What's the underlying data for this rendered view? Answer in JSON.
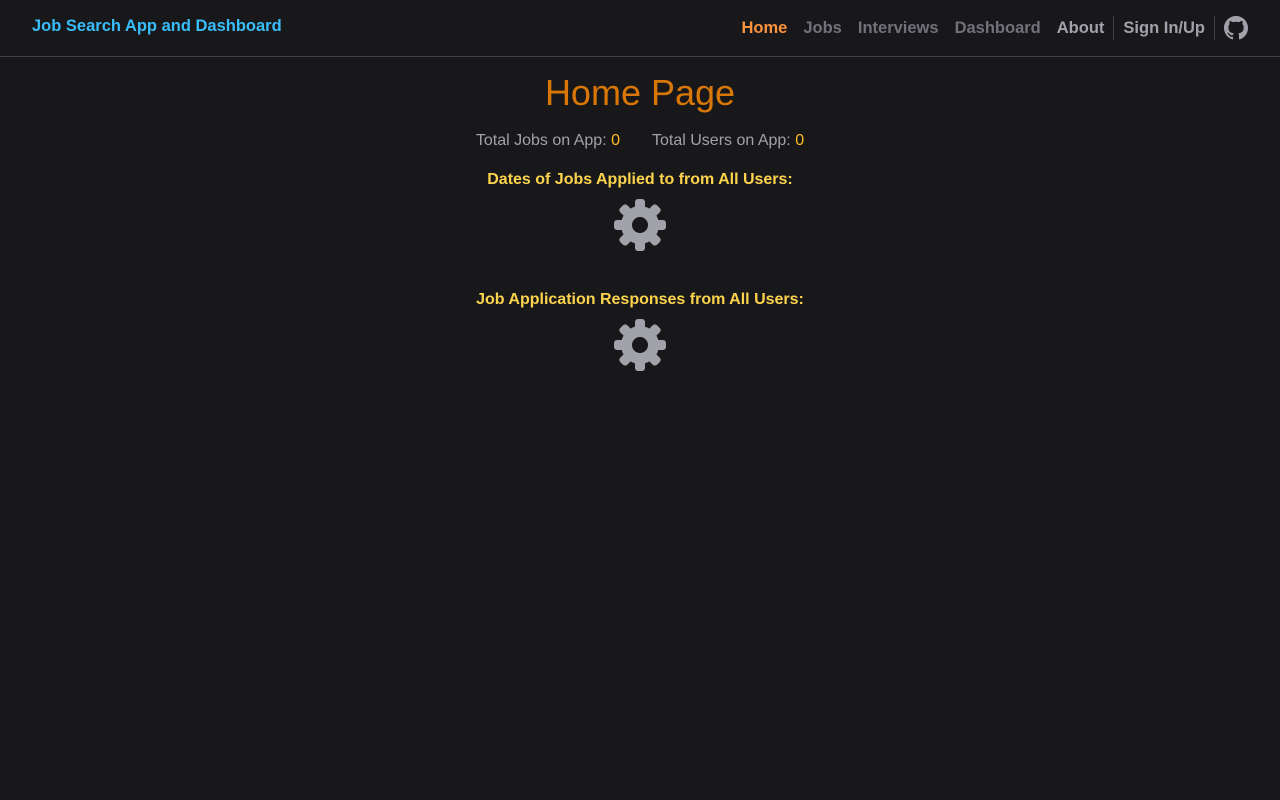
{
  "navbar": {
    "brand": "Job Search App and Dashboard",
    "links": [
      {
        "label": "Home",
        "color": "#fb923c"
      },
      {
        "label": "Jobs",
        "color": "#71717a"
      },
      {
        "label": "Interviews",
        "color": "#71717a"
      },
      {
        "label": "Dashboard",
        "color": "#71717a"
      },
      {
        "label": "About",
        "color": "#a1a1aa"
      },
      {
        "label": "Sign In/Up",
        "color": "#a1a1aa"
      }
    ],
    "github_icon": "github-icon"
  },
  "main": {
    "title": "Home Page",
    "stats": {
      "jobs_label": "Total Jobs on App:",
      "jobs_value": "0",
      "users_label": "Total Users on App:",
      "users_value": "0"
    },
    "sections": [
      {
        "heading": "Dates of Jobs Applied to from All Users:",
        "icon": "gear-icon"
      },
      {
        "heading": "Job Application Responses from All Users:",
        "icon": "gear-icon"
      }
    ]
  },
  "colors": {
    "background": "#18181b",
    "brand": "#38bdf8",
    "active_nav": "#fb923c",
    "title": "#d97706",
    "heading": "#fcd34d",
    "stat_value": "#fbbf24",
    "spinner": "#a1a1aa"
  }
}
